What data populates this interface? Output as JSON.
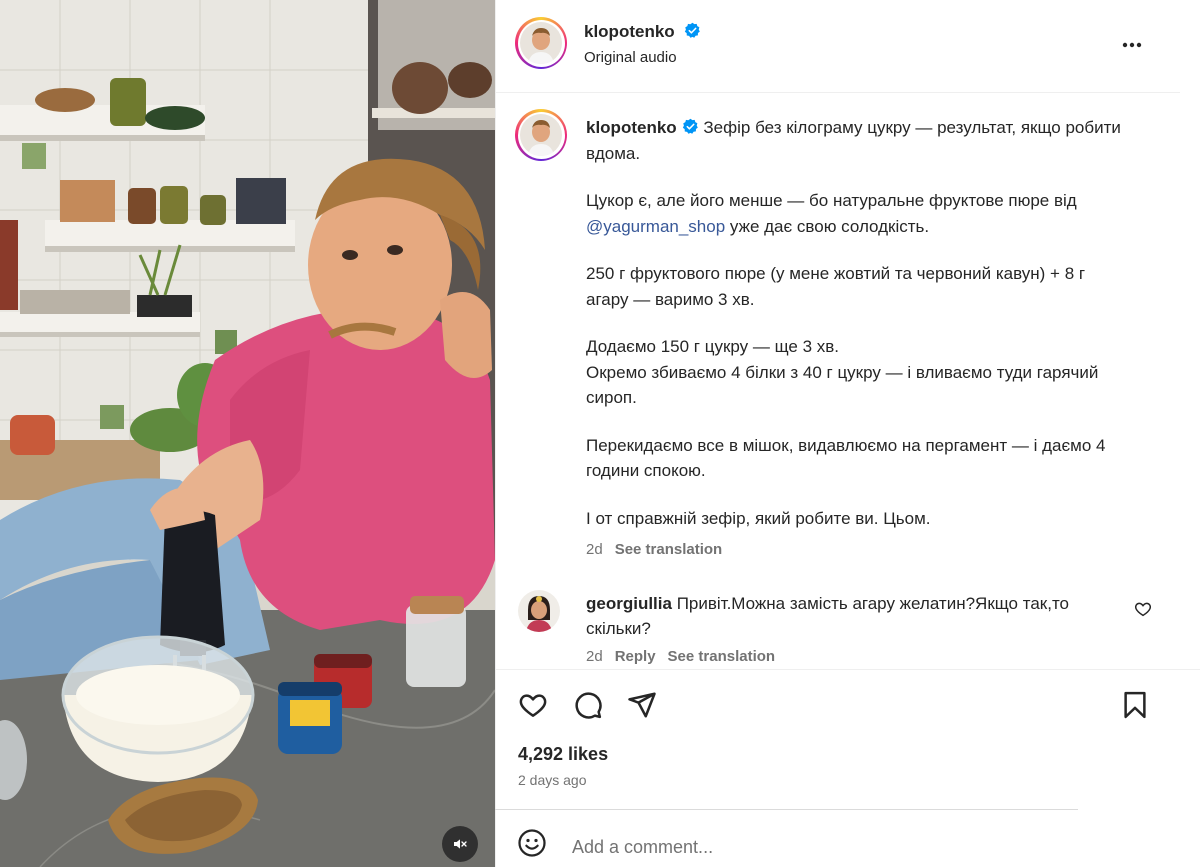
{
  "post": {
    "username": "klopotenko",
    "audio_label": "Original audio",
    "verified": true
  },
  "caption": {
    "username": "klopotenko",
    "line1": "Зефір без кілограму цукру — результат, якщо робити вдома.",
    "para2_before": "Цукор є, але його менше — бо натуральне фруктове пюре від ",
    "para2_mention": "@yagurman_shop",
    "para2_after": " уже дає свою солодкість.",
    "para3": "250 г фруктового пюре (у мене жовтий та червоний кавун) + 8 г агару — варимо 3 хв.",
    "para4_line1": "Додаємо 150 г цукру — ще 3 хв.",
    "para4_line2": "Окремо збиваємо 4 білки з 40 г цукру — і вливаємо туди гарячий сироп.",
    "para5": "Перекидаємо все в мішок, видавлюємо на пергамент — і даємо 4 години спокою.",
    "para6": "І от справжній зефір, який робите ви. Цьом.",
    "age": "2d",
    "see_translation": "See translation"
  },
  "comment": {
    "username": "georgiullia",
    "text": "Привіт.Можна замість агару желатин?Якщо так,то скільки?",
    "age": "2d",
    "reply": "Reply",
    "see_translation": "See translation"
  },
  "stats": {
    "likes": "4,292 likes",
    "posted": "2 days ago"
  },
  "composer": {
    "placeholder": "Add a comment..."
  },
  "icons": {
    "more": "more-options-icon",
    "like": "heart-icon",
    "comment": "comment-bubble-icon",
    "share": "paper-plane-icon",
    "save": "bookmark-icon",
    "emoji": "emoji-icon",
    "mute": "speaker-muted-icon",
    "verified": "verified-badge-icon"
  },
  "colors": {
    "verified": "#0095f6",
    "link": "#385898",
    "muted_text": "#737373"
  }
}
